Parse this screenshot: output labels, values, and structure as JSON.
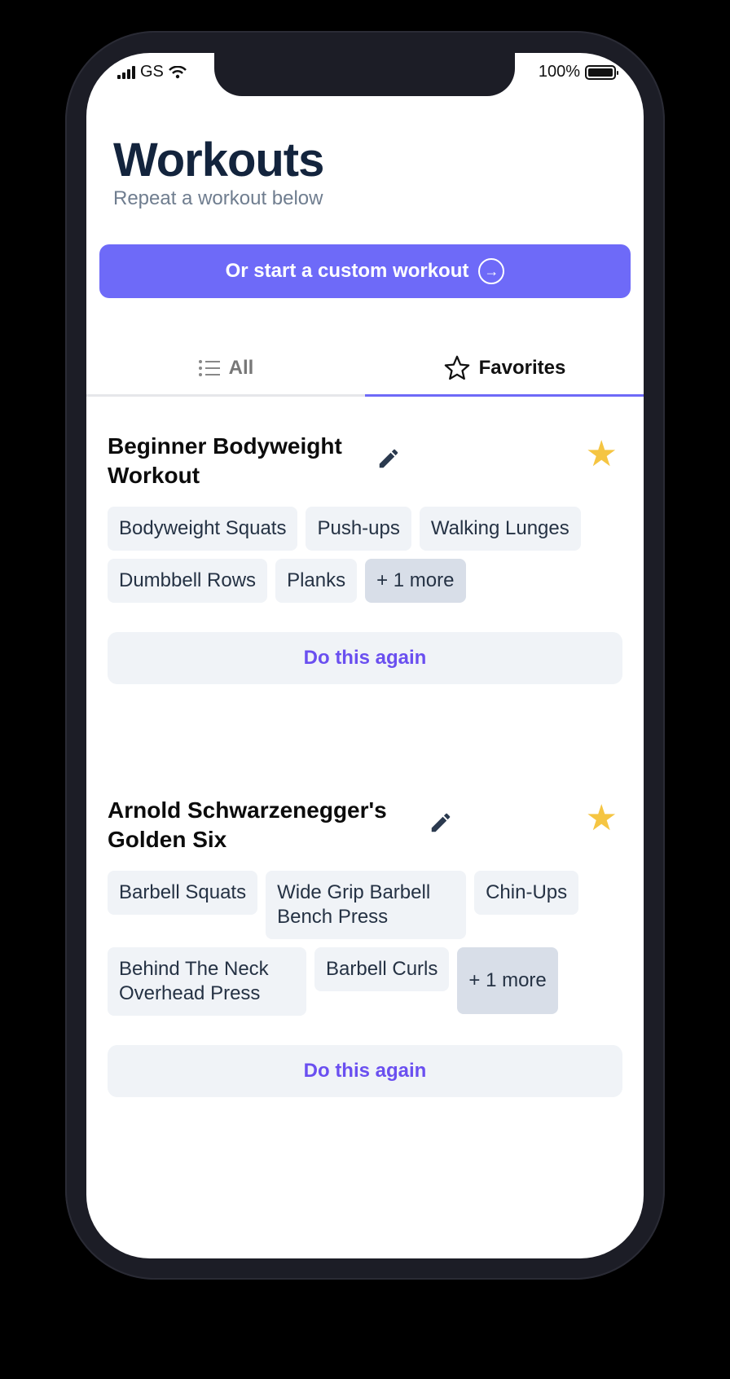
{
  "status_bar": {
    "carrier": "GS",
    "battery": "100%"
  },
  "header": {
    "title": "Workouts",
    "subtitle": "Repeat a workout below"
  },
  "cta": {
    "label": "Or start a custom workout"
  },
  "tabs": [
    {
      "label": "All",
      "icon": "list-icon"
    },
    {
      "label": "Favorites",
      "icon": "star-outline-icon",
      "active": true
    }
  ],
  "colors": {
    "accent": "#6e6af8",
    "star": "#f5c542",
    "title": "#13243d"
  },
  "workouts": [
    {
      "title": "Beginner Bodyweight Workout",
      "favorite": true,
      "exercises": [
        "Bodyweight Squats",
        "Push-ups",
        "Walking Lunges",
        "Dumbbell Rows",
        "Planks"
      ],
      "more": "+ 1 more",
      "action": "Do this again"
    },
    {
      "title": "Arnold Schwarzenegger's Golden Six",
      "favorite": true,
      "exercises": [
        "Barbell Squats",
        "Wide Grip Barbell Bench Press",
        "Chin-Ups",
        "Behind The Neck Overhead Press",
        "Barbell Curls"
      ],
      "more": "+ 1 more",
      "action": "Do this again"
    }
  ]
}
